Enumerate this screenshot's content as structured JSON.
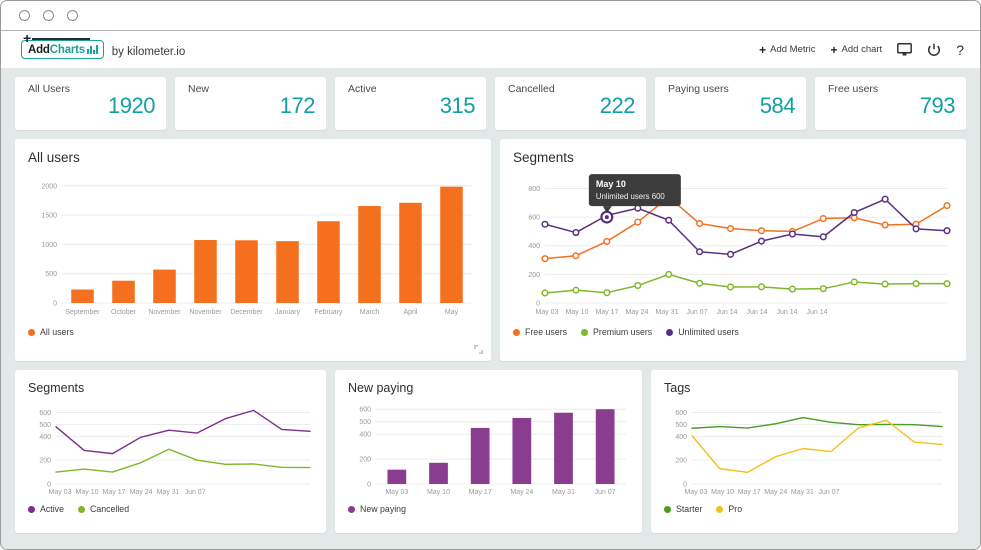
{
  "window": {
    "dots": [
      "minimize-dot",
      "maximize-dot",
      "close-dot"
    ]
  },
  "appbar": {
    "logo_add": "Add",
    "logo_charts": "Charts",
    "byline": "by kilometer.io",
    "add_metric": "Add Metric",
    "add_chart": "Add chart",
    "plus": "+",
    "help": "?",
    "icons": [
      "monitor-icon",
      "power-icon",
      "help-icon"
    ]
  },
  "kpis": [
    {
      "label": "All Users",
      "value": "1920"
    },
    {
      "label": "New",
      "value": "172"
    },
    {
      "label": "Active",
      "value": "315"
    },
    {
      "label": "Cancelled",
      "value": "222"
    },
    {
      "label": "Paying users",
      "value": "584"
    },
    {
      "label": "Free users",
      "value": "793"
    }
  ],
  "colors": {
    "accent": "#11a0a0",
    "orange": "#f4701f",
    "green": "#7fb82a",
    "purple": "#5b2d82",
    "magenta": "#8a3d8f",
    "dark_green": "#4a9a26",
    "yellow": "#f2c11c",
    "background": "#e3e9e9"
  },
  "cards": {
    "all_users": {
      "title": "All users"
    },
    "segments_top": {
      "title": "Segments"
    },
    "segments_bottom": {
      "title": "Segments"
    },
    "new_paying": {
      "title": "New paying"
    },
    "tags": {
      "title": "Tags"
    }
  },
  "tooltip": {
    "title": "May 10",
    "body": "Unlimited users 600"
  },
  "chart_data": [
    {
      "id": "all-users",
      "type": "bar",
      "title": "All users",
      "categories": [
        "September",
        "October",
        "November",
        "November",
        "December",
        "January",
        "February",
        "March",
        "April",
        "May"
      ],
      "values": [
        230,
        380,
        570,
        1075,
        1070,
        1055,
        1395,
        1655,
        1710,
        1985
      ],
      "yticks": [
        0,
        500,
        1000,
        1500,
        2000
      ],
      "ylim": [
        0,
        2150
      ],
      "xlabel": "",
      "ylabel": "",
      "grid": true,
      "legend": [
        {
          "name": "All users",
          "color": "#f4701f"
        }
      ],
      "legend_position": "bottom-left"
    },
    {
      "id": "segments-top",
      "type": "line",
      "title": "Segments",
      "x": [
        "May 03",
        "",
        "May 10",
        "",
        "May 17",
        "",
        "May 24",
        "",
        "May 31",
        "",
        "Jun 07",
        "",
        "Jun 14",
        "",
        "Jun 14",
        "",
        "Jun 14",
        "",
        "Jun 14"
      ],
      "xticks": [
        "May 03",
        "May 10",
        "May 17",
        "May 24",
        "May 31",
        "Jun 07",
        "Jun 14",
        "Jun 14",
        "Jun 14",
        "Jun 14"
      ],
      "yticks": [
        0,
        200,
        400,
        600,
        800
      ],
      "ylim": [
        0,
        880
      ],
      "grid": true,
      "series": [
        {
          "name": "Free users",
          "color": "#f4701f",
          "values": [
            310,
            330,
            430,
            565,
            740,
            555,
            520,
            505,
            500,
            590,
            595,
            545,
            550,
            680
          ]
        },
        {
          "name": "Premium users",
          "color": "#7fb82a",
          "values": [
            70,
            90,
            72,
            122,
            200,
            138,
            112,
            113,
            97,
            100,
            147,
            132,
            135,
            135
          ]
        },
        {
          "name": "Unlimited users",
          "color": "#5b2d82",
          "values": [
            550,
            492,
            612,
            662,
            578,
            358,
            340,
            432,
            482,
            462,
            632,
            725,
            518,
            505
          ]
        }
      ],
      "legend_position": "bottom-left",
      "annotation": {
        "x_label": "May 10",
        "series": "Unlimited users",
        "value": 600
      }
    },
    {
      "id": "segments-bottom",
      "type": "line",
      "title": "Segments",
      "xticks": [
        "May 03",
        "May 10",
        "May 17",
        "May 24",
        "May 31",
        "Jun 07"
      ],
      "yticks": [
        0,
        200,
        400,
        500,
        600
      ],
      "ylim": [
        0,
        680
      ],
      "grid": true,
      "series": [
        {
          "name": "Active",
          "color": "#7b2e8e",
          "values": [
            480,
            282,
            255,
            392,
            452,
            428,
            548,
            618,
            458,
            442
          ]
        },
        {
          "name": "Cancelled",
          "color": "#7fb82a",
          "values": [
            100,
            125,
            100,
            178,
            292,
            200,
            165,
            168,
            140,
            138
          ]
        }
      ],
      "legend_position": "bottom-left"
    },
    {
      "id": "new-paying",
      "type": "bar",
      "title": "New paying",
      "categories": [
        "May 03",
        "May 10",
        "May 17",
        "May 24",
        "May 31",
        "Jun 07"
      ],
      "values": [
        115,
        170,
        450,
        530,
        572,
        600
      ],
      "yticks": [
        0,
        200,
        400,
        500,
        600
      ],
      "ylim": [
        0,
        650
      ],
      "grid": true,
      "legend": [
        {
          "name": "New paying",
          "color": "#8a3d8f"
        }
      ],
      "legend_position": "bottom-left"
    },
    {
      "id": "tags",
      "type": "line",
      "title": "Tags",
      "xticks": [
        "May 03",
        "May 10",
        "May 17",
        "May 24",
        "May 31",
        "Jun 07"
      ],
      "yticks": [
        0,
        200,
        400,
        500,
        600
      ],
      "ylim": [
        0,
        680
      ],
      "grid": true,
      "series": [
        {
          "name": "Starter",
          "color": "#4a9a26",
          "values": [
            468,
            482,
            470,
            505,
            558,
            518,
            498,
            500,
            498,
            482
          ]
        },
        {
          "name": "Pro",
          "color": "#f2c11c",
          "values": [
            405,
            128,
            98,
            228,
            298,
            272,
            472,
            535,
            352,
            332
          ]
        }
      ],
      "legend_position": "bottom-left"
    }
  ]
}
